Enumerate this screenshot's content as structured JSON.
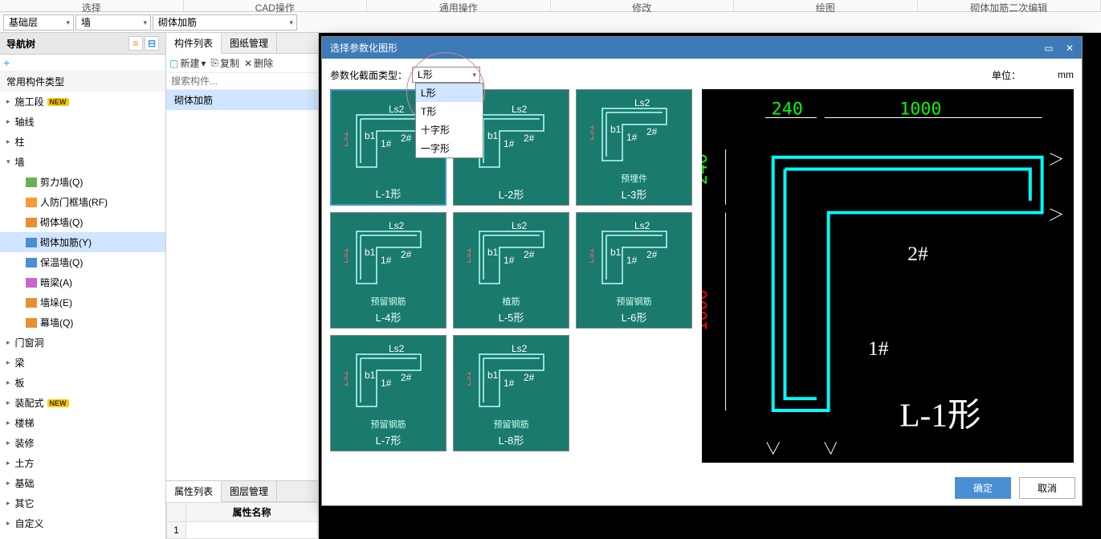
{
  "ribbon": {
    "groups": [
      "选择",
      "CAD操作",
      "通用操作",
      "修改",
      "绘图",
      "砌体加筋二次编辑"
    ]
  },
  "toolbar2": {
    "level": "基础层",
    "category": "墙",
    "component": "砌体加筋"
  },
  "nav": {
    "title": "导航树",
    "header_common": "常用构件类型",
    "groups": [
      {
        "label": "施工段",
        "new": true
      },
      {
        "label": "轴线"
      },
      {
        "label": "柱"
      },
      {
        "label": "墙",
        "expanded": true,
        "children": [
          {
            "label": "剪力墙(Q)",
            "icon": "wall"
          },
          {
            "label": "人防门框墙(RF)",
            "icon": "door"
          },
          {
            "label": "砌体墙(Q)",
            "icon": "brick"
          },
          {
            "label": "砌体加筋(Y)",
            "icon": "rebar",
            "selected": true
          },
          {
            "label": "保温墙(Q)",
            "icon": "insulation"
          },
          {
            "label": "暗梁(A)",
            "icon": "beam"
          },
          {
            "label": "墙垛(E)",
            "icon": "pier"
          },
          {
            "label": "幕墙(Q)",
            "icon": "curtain"
          }
        ]
      },
      {
        "label": "门窗洞"
      },
      {
        "label": "梁"
      },
      {
        "label": "板"
      },
      {
        "label": "装配式",
        "new": true
      },
      {
        "label": "楼梯"
      },
      {
        "label": "装修"
      },
      {
        "label": "土方"
      },
      {
        "label": "基础"
      },
      {
        "label": "其它"
      },
      {
        "label": "自定义"
      }
    ]
  },
  "center": {
    "tabs": [
      "构件列表",
      "图纸管理"
    ],
    "active_tab": 0,
    "btn_new": "新建",
    "btn_copy": "复制",
    "btn_delete": "删除",
    "search_placeholder": "搜索构件...",
    "item": "砌体加筋"
  },
  "props": {
    "tabs": [
      "属性列表",
      "图层管理"
    ],
    "active_tab": 0,
    "col_name": "属性名称",
    "row1": "1"
  },
  "dialog": {
    "title": "选择参数化图形",
    "section_type_label": "参数化截面类型：",
    "section_type_value": "L形",
    "dropdown_options": [
      "L形",
      "T形",
      "十字形",
      "一字形"
    ],
    "unit_label": "单位：",
    "unit_value": "mm",
    "thumbs": [
      {
        "name": "L-1形",
        "sub": ""
      },
      {
        "name": "L-2形",
        "sub": ""
      },
      {
        "name": "L-3形",
        "sub": "预埋件"
      },
      {
        "name": "L-4形",
        "sub": "预留钢筋"
      },
      {
        "name": "L-5形",
        "sub": "植筋"
      },
      {
        "name": "L-6形",
        "sub": "预留钢筋"
      },
      {
        "name": "L-7形",
        "sub": "预留钢筋"
      },
      {
        "name": "L-8形",
        "sub": "预留钢筋"
      }
    ],
    "selected_thumb": 0,
    "btn_ok": "确定",
    "btn_cancel": "取消"
  },
  "preview": {
    "dim_h1": "240",
    "dim_h2": "1000",
    "dim_v1": "240",
    "dim_v2": "1000",
    "label1": "1#",
    "label2": "2#",
    "shape_name": "L-1形"
  }
}
